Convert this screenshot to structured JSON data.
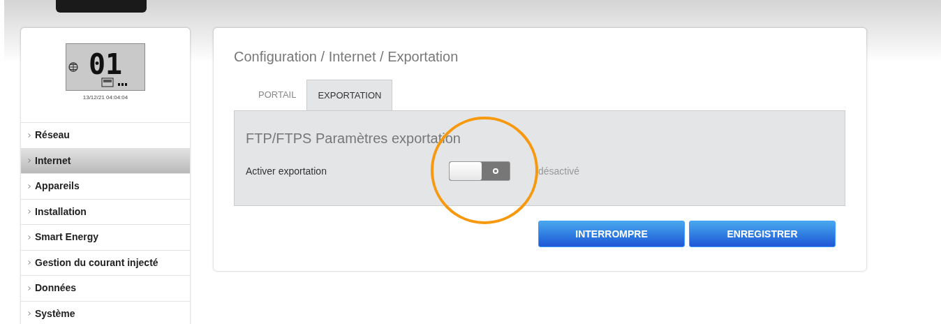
{
  "device": {
    "display_value": "01",
    "timestamp": "13/12/21 04:04:04"
  },
  "sidebar": {
    "items": [
      {
        "label": "Réseau",
        "selected": false
      },
      {
        "label": "Internet",
        "selected": true
      },
      {
        "label": "Appareils",
        "selected": false
      },
      {
        "label": "Installation",
        "selected": false
      },
      {
        "label": "Smart Energy",
        "selected": false
      },
      {
        "label": "Gestion du courant injecté",
        "selected": false
      },
      {
        "label": "Données",
        "selected": false
      },
      {
        "label": "Système",
        "selected": false
      }
    ]
  },
  "breadcrumb": "Configuration / Internet / Exportation",
  "tabs": [
    {
      "label": "PORTAIL",
      "selected": false
    },
    {
      "label": "EXPORTATION",
      "selected": true
    }
  ],
  "section": {
    "title": "FTP/FTPS Paramètres exportation",
    "setting": {
      "label": "Activer exportation",
      "on": false,
      "status": "désactivé"
    }
  },
  "buttons": [
    "INTERROMPRE",
    "ENREGISTRER"
  ]
}
